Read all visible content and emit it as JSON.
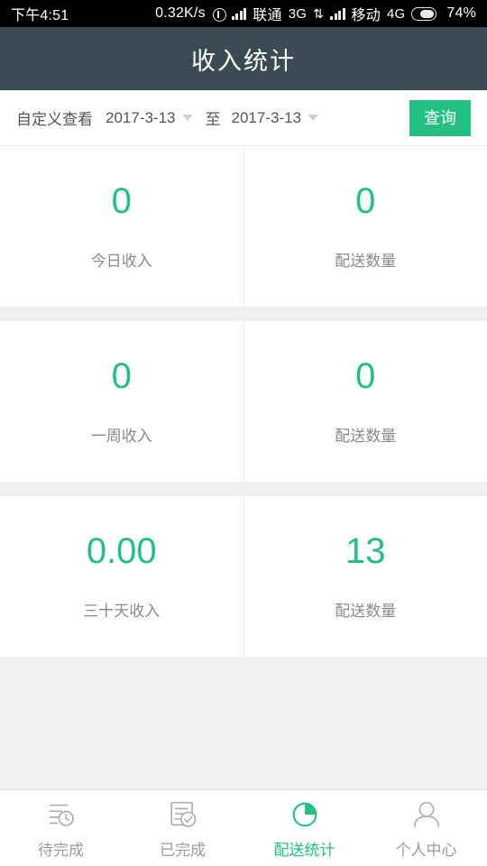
{
  "status_bar": {
    "time": "下午4:51",
    "network_speed": "0.32K/s",
    "location_icon": "location-icon",
    "signal_icon_1": "signal-bars-icon",
    "carrier_1": "联通",
    "network_type_1": "3G",
    "data_transfer_icon": "up-down-arrows-icon",
    "signal_icon_2": "signal-bars-icon",
    "carrier_2": "移动",
    "network_type_2": "4G",
    "battery_icon": "battery-icon",
    "battery_percent": "74%"
  },
  "header": {
    "title": "收入统计",
    "background_color": "#3b4b53"
  },
  "filter": {
    "label": "自定义查看",
    "start_date": "2017-3-13",
    "between_label": "至",
    "end_date": "2017-3-13",
    "caret_icon": "chevron-down-icon",
    "query_button": "查询",
    "accent_color": "#22c183"
  },
  "stats": {
    "accent_color": "#22c183",
    "rows": [
      {
        "left": {
          "value": "0",
          "label": "今日收入"
        },
        "right": {
          "value": "0",
          "label": "配送数量"
        }
      },
      {
        "left": {
          "value": "0",
          "label": "一周收入"
        },
        "right": {
          "value": "0",
          "label": "配送数量"
        }
      },
      {
        "left": {
          "value": "0.00",
          "label": "三十天收入"
        },
        "right": {
          "value": "13",
          "label": "配送数量"
        }
      }
    ]
  },
  "tabbar": {
    "active_color": "#22c183",
    "inactive_color": "#9b9b9b",
    "items": [
      {
        "label": "待完成",
        "icon": "list-clock-icon",
        "active": false
      },
      {
        "label": "已完成",
        "icon": "document-check-icon",
        "active": false
      },
      {
        "label": "配送统计",
        "icon": "pie-chart-icon",
        "active": true
      },
      {
        "label": "个人中心",
        "icon": "person-icon",
        "active": false
      }
    ]
  }
}
